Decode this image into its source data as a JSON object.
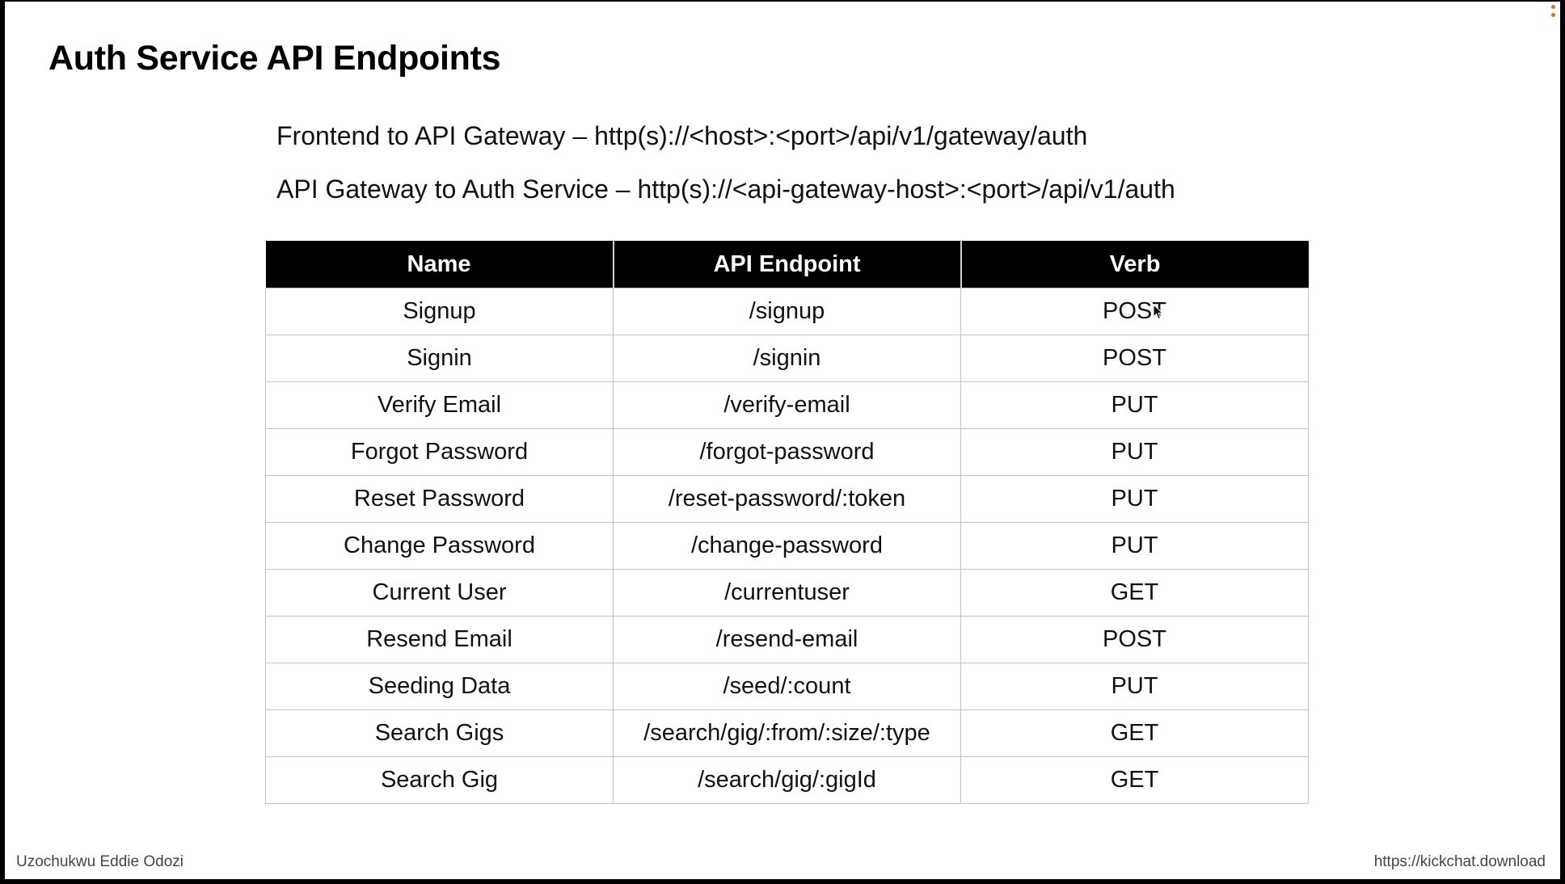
{
  "slide": {
    "title": "Auth Service API Endpoints",
    "url_lines": [
      "Frontend to API Gateway – http(s)://<host>:<port>/api/v1/gateway/auth",
      "API Gateway to Auth Service – http(s)://<api-gateway-host>:<port>/api/v1/auth"
    ]
  },
  "table": {
    "headers": [
      "Name",
      "API Endpoint",
      "Verb"
    ],
    "rows": [
      [
        "Signup",
        "/signup",
        "POST"
      ],
      [
        "Signin",
        "/signin",
        "POST"
      ],
      [
        "Verify Email",
        "/verify-email",
        "PUT"
      ],
      [
        "Forgot Password",
        "/forgot-password",
        "PUT"
      ],
      [
        "Reset Password",
        "/reset-password/:token",
        "PUT"
      ],
      [
        "Change Password",
        "/change-password",
        "PUT"
      ],
      [
        "Current User",
        "/currentuser",
        "GET"
      ],
      [
        "Resend Email",
        "/resend-email",
        "POST"
      ],
      [
        "Seeding Data",
        "/seed/:count",
        "PUT"
      ],
      [
        "Search Gigs",
        "/search/gig/:from/:size/:type",
        "GET"
      ],
      [
        "Search Gig",
        "/search/gig/:gigId",
        "GET"
      ]
    ]
  },
  "footer": {
    "author": "Uzochukwu Eddie Odozi",
    "url": "https://kickchat.download"
  },
  "icons": {
    "cursor": "mouse-cursor-icon",
    "recording": "recording-dot-icon"
  },
  "colors": {
    "header_bg": "#000000",
    "header_text": "#ffffff",
    "border": "#c4c4c4",
    "recording_dot": "#e07020"
  }
}
